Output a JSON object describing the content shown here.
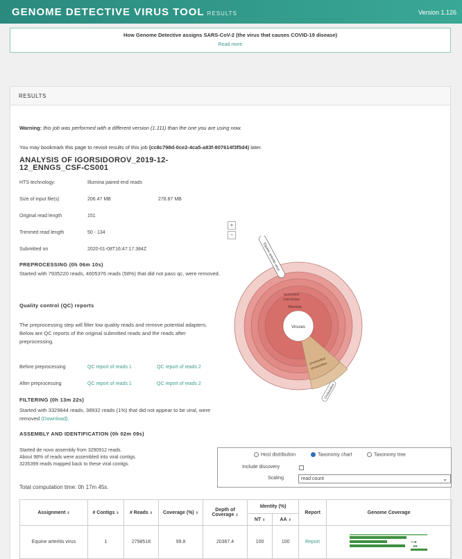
{
  "header": {
    "app_title": "GENOME DETECTIVE VIRUS TOOL",
    "subtitle": "RESULTS",
    "version": "Version 1.126"
  },
  "notice": {
    "text": "How Genome Detective assigns SARS-CoV-2 (the virus that causes COVID-19 disease)",
    "link": "Read more"
  },
  "results": {
    "heading": "RESULTS",
    "warning_label": "Warning:",
    "warning_text": "this job was performed with a different version (1.111) than the one you are using now.",
    "bookmark_prefix": "You may bookmark this page to revisit results of this job",
    "job_id": "(cc8c798d-0ce2-4ca5-a83f-807614f3f5d4)",
    "bookmark_suffix": "later.",
    "analysis_title": "ANALYSIS OF IGORSIDOROV_2019-12-12_ENNGS_CSF-CS001",
    "info": {
      "hts_label": "HTS technology:",
      "hts_value": "Illumina paired-end reads",
      "size_label": "Size of input file(s)",
      "size_value1": "206.47 MB",
      "size_value2": "278.87 MB",
      "orig_label": "Original read length",
      "orig_value": "151",
      "trim_label": "Trimmed read length",
      "trim_value": "50 - 134",
      "submitted_label": "Submitted on",
      "submitted_value": "2020-01-08T16:47:17.384Z"
    },
    "preprocessing_heading": "PREPROCESSING (0h 06m 10s)",
    "preprocessing_text": "Started with 7935220 reads, 4605376 reads (58%) that did not pass qc, were removed.",
    "qc_heading": "Quality control (QC) reports",
    "qc_text": "The preprocessing step will filter low quality reads and remove potential adapters. Below are QC reports of the original submitted reads and the reads after preprocessing.",
    "before_label": "Before preprocessing",
    "after_label": "After preprocessing",
    "qc_link1": "QC report of reads 1",
    "qc_link2": "QC report of reads 2",
    "filtering_heading": "FILTERING (0h 13m 22s)",
    "filtering_text": "Started with 3329844 reads, 38932 reads (1%) that did not appear to be viral, were removed",
    "download_link": "(Download).",
    "assembly_heading": "ASSEMBLY AND IDENTIFICATION (0h 02m 09s)",
    "assembly_line1": "Started de novo assembly from 3290912 reads.",
    "assembly_line2": "About 98% of reads were assembled into viral contigs.",
    "assembly_line3": "3235399 reads mapped back to these viral contigs.",
    "total_time": "Total computation time: 0h 17m 45s."
  },
  "zoom": {
    "plus": "+",
    "minus": "−"
  },
  "sunburst": {
    "center_label": "Viruses",
    "ring1_label": "Riboviria",
    "ring2_label": "Nidovirales",
    "ring2b_label": "Arteriviridae",
    "tan_label1": "Unclassified",
    "tan_label2": "Unclassified",
    "tan_outer_label": "Unclassified",
    "callout_label": "Equine arteritis virus",
    "colors": {
      "red": "#e89a96",
      "tan": "#d9b48a",
      "pale": "#f3cfcc"
    }
  },
  "controls": {
    "radio1": "Host distribution",
    "radio2": "Taxonomy chart",
    "radio3": "Taxonomy tree",
    "include_label": "Include discovery",
    "scaling_label": "Scaling",
    "scaling_value": "read count"
  },
  "table": {
    "headers": {
      "assignment": "Assignment",
      "contigs": "# Contigs",
      "reads": "# Reads",
      "coverage": "Coverage (%)",
      "depth": "Depth of Coverage",
      "identity": "Identity (%)",
      "nt": "NT",
      "aa": "AA",
      "report": "Report",
      "genome": "Genome Coverage"
    },
    "row": {
      "assignment": "Equine arteritis virus",
      "contigs": "1",
      "reads": "2798518",
      "coverage": "99.8",
      "depth": "20367.4",
      "nt": "100",
      "aa": "100",
      "report": "Report"
    }
  }
}
